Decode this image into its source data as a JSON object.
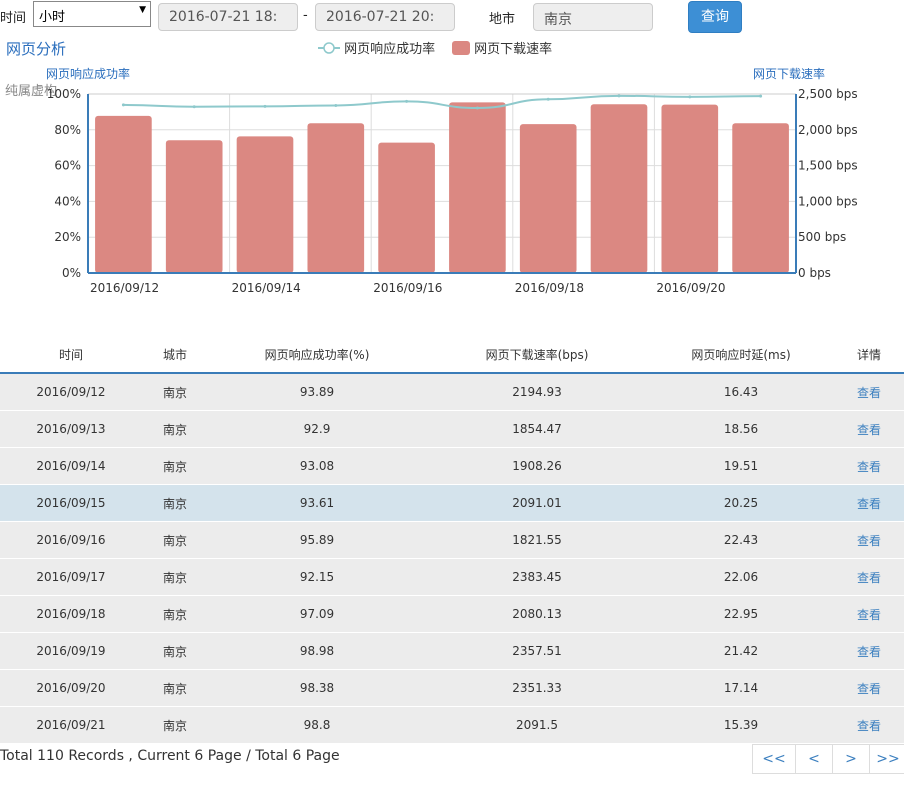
{
  "filter": {
    "time_label": "时间",
    "granularity": "小时",
    "start": "2016-07-21 18:",
    "dash": "-",
    "end": "2016-07-21 20:",
    "city_label": "地市",
    "city_value": "南京",
    "query_button": "查询"
  },
  "panel": {
    "title": "网页分析",
    "ghost_text": "纯属虚构"
  },
  "chart_data": {
    "type": "bar",
    "legend_position": "top-center",
    "grid": true,
    "categories": [
      "2016/09/12",
      "2016/09/13",
      "2016/09/14",
      "2016/09/15",
      "2016/09/16",
      "2016/09/17",
      "2016/09/18",
      "2016/09/19",
      "2016/09/20",
      "2016/09/21"
    ],
    "x_tick_labels": [
      "2016/09/12",
      "",
      "2016/09/14",
      "",
      "2016/09/16",
      "",
      "2016/09/18",
      "",
      "2016/09/20",
      ""
    ],
    "series": [
      {
        "name": "网页下载速率",
        "type": "bar",
        "axis": "right",
        "color": "#db8882",
        "values": [
          2194.93,
          1854.47,
          1908.26,
          2091.01,
          1821.55,
          2383.45,
          2080.13,
          2357.51,
          2351.33,
          2091.5
        ]
      },
      {
        "name": "网页响应成功率",
        "type": "line",
        "axis": "left",
        "color": "#8ec9cc",
        "values": [
          93.89,
          92.9,
          93.08,
          93.61,
          95.89,
          92.15,
          97.09,
          98.98,
          98.38,
          98.8
        ]
      }
    ],
    "y_left": {
      "label": "网页响应成功率",
      "range": [
        0,
        100
      ],
      "ticks": [
        "0%",
        "20%",
        "40%",
        "60%",
        "80%",
        "100%"
      ]
    },
    "y_right": {
      "label": "网页下载速率",
      "range": [
        0,
        2500
      ],
      "ticks": [
        "0 bps",
        "500 bps",
        "1,000 bps",
        "1,500 bps",
        "2,000 bps",
        "2,500 bps"
      ]
    }
  },
  "table": {
    "headers": [
      "时间",
      "城市",
      "网页响应成功率(%)",
      "网页下载速率(bps)",
      "网页响应时延(ms)",
      "详情"
    ],
    "link_text": "查看",
    "rows": [
      [
        "2016/09/12",
        "南京",
        "93.89",
        "2194.93",
        "16.43"
      ],
      [
        "2016/09/13",
        "南京",
        "92.9",
        "1854.47",
        "18.56"
      ],
      [
        "2016/09/14",
        "南京",
        "93.08",
        "1908.26",
        "19.51"
      ],
      [
        "2016/09/15",
        "南京",
        "93.61",
        "2091.01",
        "20.25"
      ],
      [
        "2016/09/16",
        "南京",
        "95.89",
        "1821.55",
        "22.43"
      ],
      [
        "2016/09/17",
        "南京",
        "92.15",
        "2383.45",
        "22.06"
      ],
      [
        "2016/09/18",
        "南京",
        "97.09",
        "2080.13",
        "22.95"
      ],
      [
        "2016/09/19",
        "南京",
        "98.98",
        "2357.51",
        "21.42"
      ],
      [
        "2016/09/20",
        "南京",
        "98.38",
        "2351.33",
        "17.14"
      ],
      [
        "2016/09/21",
        "南京",
        "98.8",
        "2091.5",
        "15.39"
      ]
    ]
  },
  "footer": {
    "summary": "Total 110 Records , Current 6 Page / Total 6 Page",
    "pager": [
      "<<",
      "<",
      ">",
      ">>"
    ]
  }
}
